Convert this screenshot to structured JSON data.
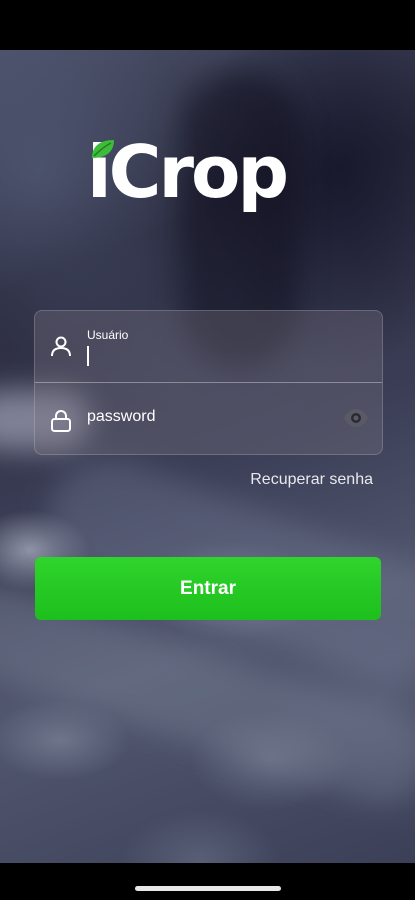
{
  "app": {
    "logo_text": "iCrop",
    "leaf_color": "#3dbb3a"
  },
  "login": {
    "username_label": "Usuário",
    "username_value": "",
    "password_placeholder": "password",
    "password_value": "",
    "recover_link": "Recuperar senha",
    "submit_label": "Entrar"
  },
  "icons": {
    "user": "user-icon",
    "lock": "lock-icon",
    "eye": "eye-icon",
    "leaf": "leaf-icon"
  },
  "colors": {
    "accent_green": "#22c520",
    "text_white": "#ffffff"
  }
}
